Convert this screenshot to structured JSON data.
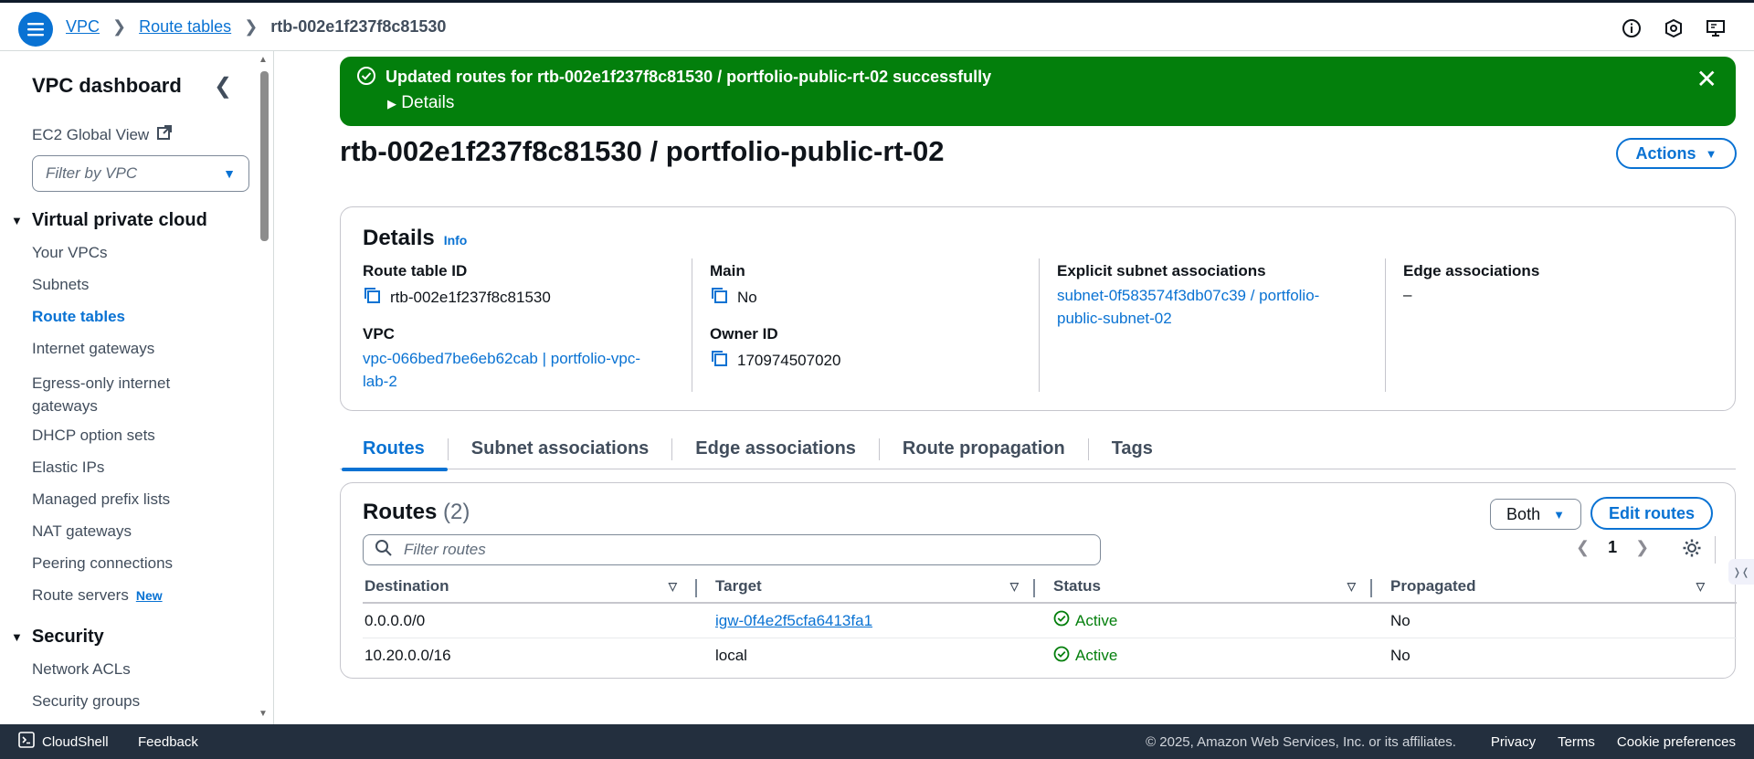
{
  "topbar": {
    "breadcrumbs": [
      "VPC",
      "Route tables",
      "rtb-002e1f237f8c81530"
    ]
  },
  "sidebar": {
    "title": "VPC dashboard",
    "global_view": "EC2 Global View",
    "filter_placeholder": "Filter by VPC",
    "sections": [
      {
        "title": "Virtual private cloud"
      },
      {
        "title": "Security"
      }
    ],
    "items": [
      {
        "label": "Your VPCs"
      },
      {
        "label": "Subnets"
      },
      {
        "label": "Route tables"
      },
      {
        "label": "Internet gateways"
      },
      {
        "label": "Egress-only internet gateways"
      },
      {
        "label": "DHCP option sets"
      },
      {
        "label": "Elastic IPs"
      },
      {
        "label": "Managed prefix lists"
      },
      {
        "label": "NAT gateways"
      },
      {
        "label": "Peering connections"
      },
      {
        "label": "Route servers",
        "badge": "New"
      },
      {
        "label": "Network ACLs"
      },
      {
        "label": "Security groups"
      }
    ]
  },
  "flash": {
    "message": "Updated routes for rtb-002e1f237f8c81530 / portfolio-public-rt-02 successfully",
    "details_label": "Details",
    "color": "#037f0c"
  },
  "page": {
    "title": "rtb-002e1f237f8c81530 / portfolio-public-rt-02",
    "actions_label": "Actions"
  },
  "details": {
    "title": "Details",
    "info": "Info",
    "route_table_id_label": "Route table ID",
    "route_table_id": "rtb-002e1f237f8c81530",
    "vpc_label": "VPC",
    "vpc_line1": "vpc-066bed7be6eb62cab | portfolio-vpc-",
    "vpc_line2": "lab-2",
    "main_label": "Main",
    "main_value": "No",
    "owner_label": "Owner ID",
    "owner_value": "170974507020",
    "subnet_assoc_label": "Explicit subnet associations",
    "subnet_assoc_line1": "subnet-0f583574f3db07c39 / portfolio-",
    "subnet_assoc_line2": "public-subnet-02",
    "edge_assoc_label": "Edge associations",
    "edge_assoc_value": "–"
  },
  "tabs": [
    "Routes",
    "Subnet associations",
    "Edge associations",
    "Route propagation",
    "Tags"
  ],
  "routes": {
    "title": "Routes",
    "count": "(2)",
    "filter_select": "Both",
    "edit_label": "Edit routes",
    "search_placeholder": "Filter routes",
    "page": "1",
    "columns": [
      "Destination",
      "Target",
      "Status",
      "Propagated"
    ],
    "rows": [
      {
        "destination": "0.0.0.0/0",
        "target": "igw-0f4e2f5cfa6413fa1",
        "status": "Active",
        "propagated": "No"
      },
      {
        "destination": "10.20.0.0/16",
        "target": "local",
        "status": "Active",
        "propagated": "No"
      }
    ]
  },
  "footer": {
    "cloudshell": "CloudShell",
    "feedback": "Feedback",
    "copyright": "© 2025, Amazon Web Services, Inc. or its affiliates.",
    "privacy": "Privacy",
    "terms": "Terms",
    "cookies": "Cookie preferences"
  }
}
